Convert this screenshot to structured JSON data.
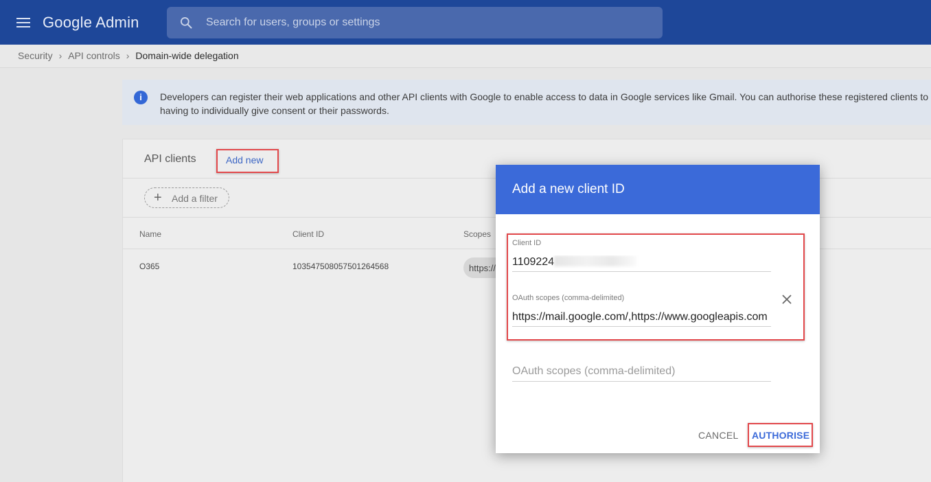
{
  "header": {
    "app_name": "Google Admin",
    "search_placeholder": "Search for users, groups or settings"
  },
  "breadcrumb": [
    "Security",
    "API controls",
    "Domain-wide delegation"
  ],
  "info_banner": {
    "text_line1": "Developers can register their web applications and other API clients with Google to enable access to data in Google services like Gmail. You can authorise these registered clients to a",
    "text_line2": "having to individually give consent or their passwords."
  },
  "api_clients": {
    "title": "API clients",
    "add_new_label": "Add new",
    "add_filter_label": "Add a filter",
    "columns": [
      "Name",
      "Client ID",
      "Scopes"
    ],
    "rows": [
      {
        "name": "O365",
        "client_id": "103547508057501264568",
        "scopes": "https://"
      }
    ]
  },
  "dialog": {
    "title": "Add a new client ID",
    "client_id_label": "Client ID",
    "client_id_value": "1109224",
    "scopes_label": "OAuth scopes (comma-delimited)",
    "scopes_value": "https://mail.google.com/,https://www.googleapis.com",
    "scopes_placeholder": "OAuth scopes (comma-delimited)",
    "cancel_label": "CANCEL",
    "authorise_label": "AUTHORISE"
  },
  "colors": {
    "header_bg": "#1e4799",
    "accent": "#3b6ad9",
    "highlight": "#e2474a"
  }
}
